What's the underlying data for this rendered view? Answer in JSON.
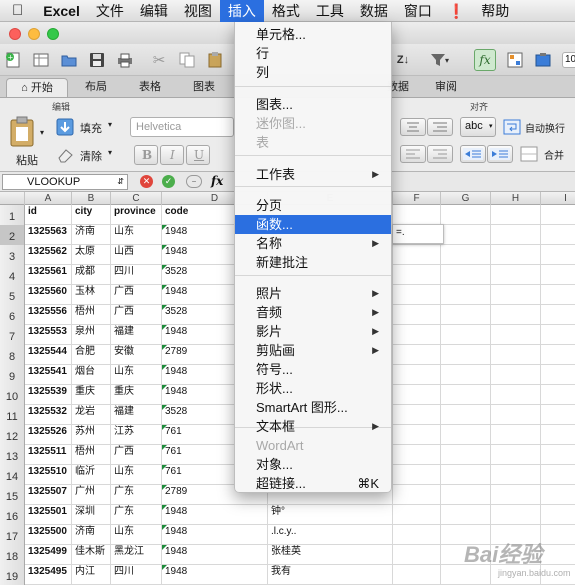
{
  "menubar": {
    "app": "Excel",
    "items": [
      "文件",
      "编辑",
      "视图",
      "插入",
      "格式",
      "工具",
      "数据",
      "窗口"
    ],
    "help": "帮助"
  },
  "tabs": [
    "开始",
    "布局",
    "表格",
    "图表",
    "数据",
    "审阅"
  ],
  "ribbon": {
    "group_edit": "编辑",
    "group_align": "对齐",
    "paste": "粘贴",
    "fill": "填充",
    "clear": "清除",
    "font": "Helvetica",
    "abc": "abc",
    "wrap": "自动换行",
    "merge": "合并",
    "bold": "B",
    "italic": "I",
    "underline": "U",
    "zoom": "10"
  },
  "formula_bar": {
    "name_box": "VLOOKUP",
    "fx": "fx"
  },
  "columns": [
    "A",
    "B",
    "C",
    "D",
    "E",
    "F",
    "G",
    "H",
    "I"
  ],
  "rows": [
    {
      "num": "1",
      "a": "id",
      "b": "city",
      "c": "province",
      "d": "code",
      "e": ""
    },
    {
      "num": "2",
      "a": "1325563",
      "b": "济南",
      "c": "山东",
      "d": "1948",
      "e": ""
    },
    {
      "num": "3",
      "a": "1325562",
      "b": "太原",
      "c": "山西",
      "d": "1948",
      "e": ""
    },
    {
      "num": "4",
      "a": "1325561",
      "b": "成都",
      "c": "四川",
      "d": "3528",
      "e": ""
    },
    {
      "num": "5",
      "a": "1325560",
      "b": "玉林",
      "c": "广西",
      "d": "1948",
      "e": ""
    },
    {
      "num": "6",
      "a": "1325556",
      "b": "梧州",
      "c": "广西",
      "d": "3528",
      "e": ""
    },
    {
      "num": "7",
      "a": "1325553",
      "b": "泉州",
      "c": "福建",
      "d": "1948",
      "e": ""
    },
    {
      "num": "8",
      "a": "1325544",
      "b": "合肥",
      "c": "安徽",
      "d": "2789",
      "e": ""
    },
    {
      "num": "9",
      "a": "1325541",
      "b": "烟台",
      "c": "山东",
      "d": "1948",
      "e": ""
    },
    {
      "num": "10",
      "a": "1325539",
      "b": "重庆",
      "c": "重庆",
      "d": "1948",
      "e": ""
    },
    {
      "num": "11",
      "a": "1325532",
      "b": "龙岩",
      "c": "福建",
      "d": "3528",
      "e": ""
    },
    {
      "num": "12",
      "a": "1325526",
      "b": "苏州",
      "c": "江苏",
      "d": "761",
      "e": ""
    },
    {
      "num": "13",
      "a": "1325511",
      "b": "梧州",
      "c": "广西",
      "d": "761",
      "e": ""
    },
    {
      "num": "14",
      "a": "1325510",
      "b": "临沂",
      "c": "山东",
      "d": "761",
      "e": ""
    },
    {
      "num": "15",
      "a": "1325507",
      "b": "广州",
      "c": "广东",
      "d": "2789",
      "e": ""
    },
    {
      "num": "16",
      "a": "1325501",
      "b": "深圳",
      "c": "广东",
      "d": "1948",
      "e": "钟°"
    },
    {
      "num": "17",
      "a": "1325500",
      "b": "济南",
      "c": "山东",
      "d": "1948",
      "e": ".l.c.y.."
    },
    {
      "num": "18",
      "a": "1325499",
      "b": "佳木斯",
      "c": "黑龙江",
      "d": "1948",
      "e": "张桂英"
    },
    {
      "num": "19",
      "a": "1325495",
      "b": "内江",
      "c": "四川",
      "d": "1948",
      "e": "我有"
    }
  ],
  "active_cell_value": "=.",
  "insert_menu": [
    {
      "label": "单元格...",
      "disabled": false,
      "submenu": false
    },
    {
      "label": "行",
      "disabled": false,
      "submenu": false
    },
    {
      "label": "列",
      "disabled": false,
      "submenu": false
    },
    {
      "label": "图表...",
      "disabled": false,
      "submenu": false
    },
    {
      "label": "迷你图...",
      "disabled": true,
      "submenu": false
    },
    {
      "label": "表",
      "disabled": true,
      "submenu": false
    },
    {
      "label": "工作表",
      "disabled": false,
      "submenu": true
    },
    {
      "label": "分页",
      "disabled": false,
      "submenu": false
    },
    {
      "label": "函数...",
      "disabled": false,
      "submenu": false,
      "highlighted": true
    },
    {
      "label": "名称",
      "disabled": false,
      "submenu": true
    },
    {
      "label": "新建批注",
      "disabled": false,
      "submenu": false
    },
    {
      "label": "照片",
      "disabled": false,
      "submenu": true
    },
    {
      "label": "音频",
      "disabled": false,
      "submenu": true
    },
    {
      "label": "影片",
      "disabled": false,
      "submenu": true
    },
    {
      "label": "剪贴画",
      "disabled": false,
      "submenu": true
    },
    {
      "label": "符号...",
      "disabled": false,
      "submenu": false
    },
    {
      "label": "形状...",
      "disabled": false,
      "submenu": false
    },
    {
      "label": "SmartArt 图形...",
      "disabled": false,
      "submenu": false
    },
    {
      "label": "文本框",
      "disabled": false,
      "submenu": true
    },
    {
      "label": "WordArt",
      "disabled": true,
      "submenu": false
    },
    {
      "label": "对象...",
      "disabled": false,
      "submenu": false
    },
    {
      "label": "超链接...",
      "disabled": false,
      "submenu": false,
      "shortcut": "⌘K"
    }
  ],
  "watermark": "Bai经验",
  "watermark_url": "jingyan.baidu.com",
  "colors": {
    "accent": "#2b6fe0",
    "menu_bg": "#f6f6f6",
    "triangle": "#1e8b3a"
  }
}
